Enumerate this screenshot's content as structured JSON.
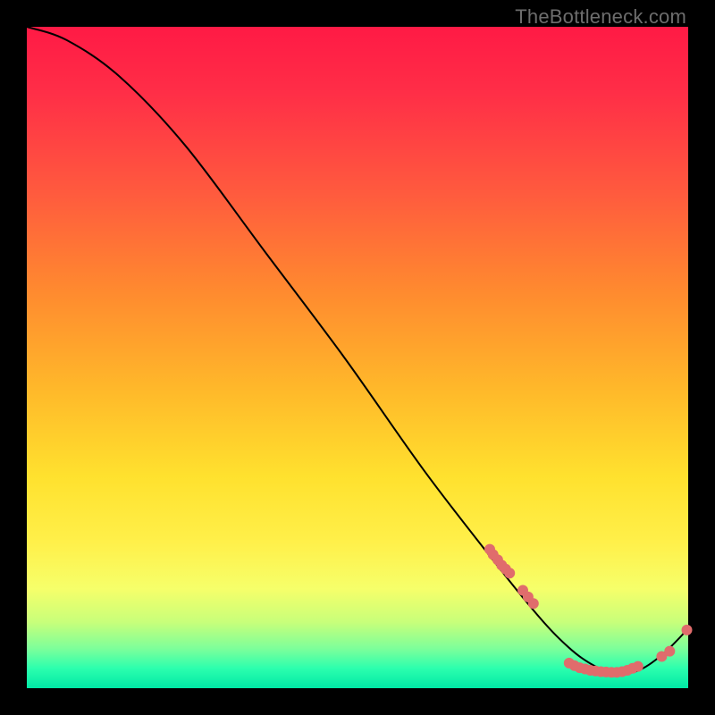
{
  "watermark": "TheBottleneck.com",
  "colors": {
    "background": "#000000",
    "watermark_text": "#6d6d6d",
    "curve": "#000000",
    "data_point": "#e06c6c",
    "gradient_top": "#ff1a45",
    "gradient_bottom": "#00e8a5"
  },
  "chart_data": {
    "type": "line",
    "title": "",
    "xlabel": "",
    "ylabel": "",
    "xlim": [
      0,
      100
    ],
    "ylim": [
      0,
      100
    ],
    "grid": false,
    "legend": false,
    "curve_points": {
      "x": [
        0,
        6,
        14,
        24,
        36,
        48,
        60,
        70,
        76,
        80,
        84,
        88,
        92,
        96,
        100
      ],
      "y": [
        100,
        98,
        92.5,
        82,
        66,
        50,
        33,
        20,
        12.5,
        8,
        4.5,
        2.5,
        2.5,
        5,
        9
      ]
    },
    "scatter_clusters": [
      {
        "x_range": [
          70,
          73
        ],
        "y_range": [
          18,
          22
        ],
        "n": 6
      },
      {
        "x_range": [
          75,
          77
        ],
        "y_range": [
          12,
          15
        ],
        "n": 3
      },
      {
        "x_range": [
          82,
          92
        ],
        "y_range": [
          2,
          4
        ],
        "n": 14
      },
      {
        "x_range": [
          96,
          98
        ],
        "y_range": [
          4,
          6
        ],
        "n": 2
      },
      {
        "x_range": [
          99,
          100
        ],
        "y_range": [
          8,
          9
        ],
        "n": 1
      }
    ],
    "scatter_points": {
      "x": [
        70.0,
        70.5,
        71.2,
        71.8,
        72.4,
        73.0,
        75.0,
        75.8,
        76.6,
        82.0,
        82.8,
        83.6,
        84.4,
        85.2,
        86.0,
        86.8,
        87.6,
        88.4,
        89.2,
        90.0,
        90.8,
        91.6,
        92.4,
        96.0,
        97.2,
        99.8
      ],
      "y": [
        21.0,
        20.2,
        19.4,
        18.6,
        18.0,
        17.4,
        14.8,
        13.8,
        12.8,
        3.8,
        3.4,
        3.1,
        2.9,
        2.7,
        2.6,
        2.5,
        2.45,
        2.4,
        2.4,
        2.5,
        2.7,
        3.0,
        3.3,
        4.8,
        5.6,
        8.8
      ]
    }
  }
}
